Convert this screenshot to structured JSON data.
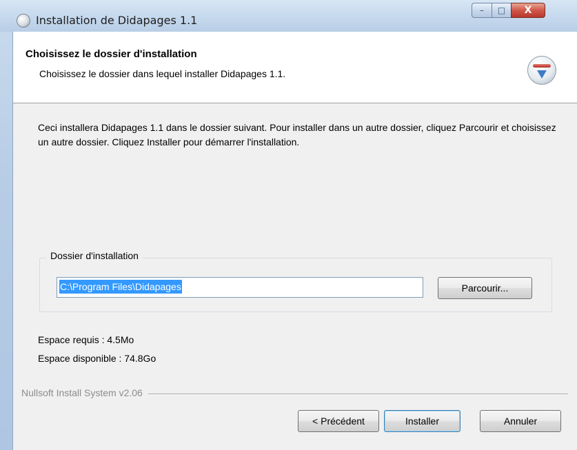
{
  "window": {
    "title": "Installation de Didapages 1.1",
    "controls": {
      "minimize": "–",
      "maximize": "□",
      "close": "X"
    }
  },
  "header": {
    "title": "Choisissez le dossier d'installation",
    "subtitle": "Choisissez le dossier dans lequel installer Didapages 1.1."
  },
  "main": {
    "description": "Ceci installera Didapages 1.1 dans le dossier suivant. Pour installer dans un autre dossier, cliquez Parcourir et choisissez un autre dossier. Cliquez Installer pour démarrer l'installation.",
    "group_label": "Dossier d'installation",
    "path_value": "C:\\Program Files\\Didapages",
    "browse_label": "Parcourir...",
    "space_required": "Espace requis : 4.5Mo",
    "space_available": "Espace disponible : 74.8Go"
  },
  "footer": {
    "branding": "Nullsoft Install System v2.06",
    "back_label": "< Précédent",
    "install_label": "Installer",
    "cancel_label": "Annuler"
  },
  "colors": {
    "selection": "#3399ff",
    "default_button_border": "#3c7fb1",
    "close_button": "#c8453a"
  }
}
